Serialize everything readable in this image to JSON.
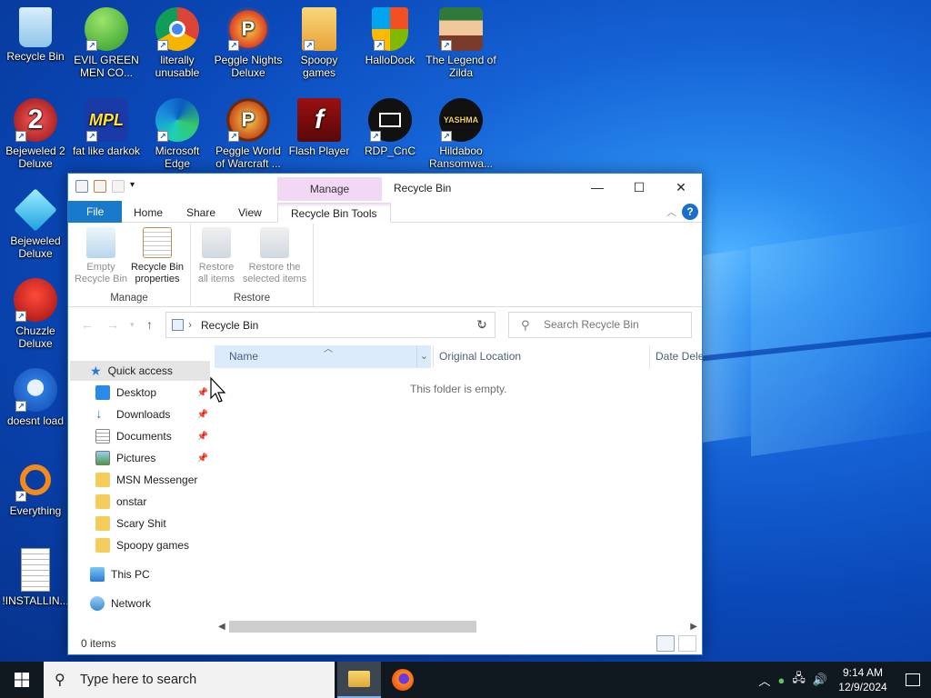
{
  "desktop_icons": [
    {
      "label": "Recycle Bin",
      "icon": "recycle-bin-icon"
    },
    {
      "label": "EVIL GREEN MEN CO...",
      "icon": "green-men-icon"
    },
    {
      "label": "literally unusable",
      "icon": "chrome-icon"
    },
    {
      "label": "Peggle Nights Deluxe",
      "icon": "peggle-icon"
    },
    {
      "label": "Spoopy games",
      "icon": "folder-icon"
    },
    {
      "label": "HalloDock",
      "icon": "shield-icon"
    },
    {
      "label": "The Legend of Zilda",
      "icon": "zilda-icon"
    },
    {
      "label": "Bejeweled 2 Deluxe",
      "icon": "bejeweled2-icon"
    },
    {
      "label": "fat like darkok",
      "icon": "mpl-icon"
    },
    {
      "label": "Microsoft Edge",
      "icon": "edge-icon"
    },
    {
      "label": "Peggle World of Warcraft ...",
      "icon": "peggle-wow-icon"
    },
    {
      "label": "Flash Player",
      "icon": "flash-icon"
    },
    {
      "label": "RDP_CnC",
      "icon": "rdp-icon"
    },
    {
      "label": "Hildaboo Ransomwa...",
      "icon": "yashma-icon"
    },
    {
      "label": "Bejeweled Deluxe",
      "icon": "bejeweled-icon"
    },
    {
      "label": "Chuzzle Deluxe",
      "icon": "chuzzle-icon"
    },
    {
      "label": "doesnt load",
      "icon": "thunderbird-icon"
    },
    {
      "label": "Everything",
      "icon": "everything-icon"
    },
    {
      "label": "!INSTALLIN...",
      "icon": "text-file-icon"
    }
  ],
  "yashma_text": "YASHMA",
  "mpl_text": "MPL",
  "explorer": {
    "title": "Recycle Bin",
    "manage_tab": "Manage",
    "tabs": [
      "File",
      "Home",
      "Share",
      "View",
      "Recycle Bin Tools"
    ],
    "ribbon": {
      "manage_group": {
        "label": "Manage",
        "buttons": [
          {
            "label": "Empty Recycle Bin",
            "line1": "Empty",
            "line2": "Recycle Bin"
          },
          {
            "label": "Recycle Bin properties",
            "line1": "Recycle Bin",
            "line2": "properties"
          }
        ]
      },
      "restore_group": {
        "label": "Restore",
        "buttons": [
          {
            "label": "Restore all items",
            "line1": "Restore",
            "line2": "all items"
          },
          {
            "label": "Restore the selected items",
            "line1": "Restore the",
            "line2": "selected items"
          }
        ]
      }
    },
    "address": "Recycle Bin",
    "search_placeholder": "Search Recycle Bin",
    "nav": {
      "quick_access": "Quick access",
      "items": [
        "Desktop",
        "Downloads",
        "Documents",
        "Pictures",
        "MSN Messenger",
        "onstar",
        "Scary Shit",
        "Spoopy games"
      ],
      "this_pc": "This PC",
      "network": "Network"
    },
    "columns": [
      "Name",
      "Original Location",
      "Date Dele"
    ],
    "empty_message": "This folder is empty.",
    "status": "0 items"
  },
  "taskbar": {
    "search_placeholder": "Type here to search",
    "time": "9:14 AM",
    "date": "12/9/2024"
  },
  "colors": {
    "accent": "#1979ca",
    "manage_tab": "#f3d8f6",
    "taskbar": "#101820"
  }
}
